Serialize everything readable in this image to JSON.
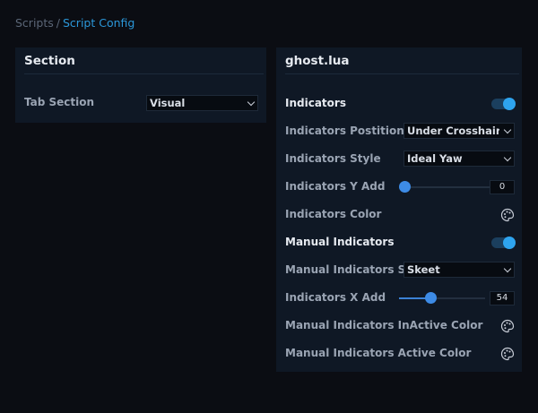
{
  "breadcrumb": {
    "root": "Scripts",
    "separator": "/",
    "current": "Script Config"
  },
  "left_panel": {
    "title": "Section",
    "tab_section": {
      "label": "Tab Section",
      "value": "Visual"
    }
  },
  "right_panel": {
    "title": "ghost.lua",
    "indicators": {
      "label": "Indicators",
      "enabled": true
    },
    "indicators_position": {
      "label": "Indicators Postition",
      "value": "Under Crosshair"
    },
    "indicators_style": {
      "label": "Indicators Style",
      "value": "Ideal Yaw"
    },
    "indicators_y_add": {
      "label": "Indicators Y Add",
      "value": "0",
      "fraction": 0.0
    },
    "indicators_color": {
      "label": "Indicators Color",
      "icon": "palette-icon"
    },
    "manual_indicators": {
      "label": "Manual Indicators",
      "enabled": true
    },
    "manual_indicators_style": {
      "label": "Manual Indicators Style",
      "value": "Skeet"
    },
    "indicators_x_add": {
      "label": "Indicators X Add",
      "value": "54",
      "fraction": 0.36
    },
    "manual_inactive_color": {
      "label": "Manual Indicators InActive Color",
      "icon": "palette-icon"
    },
    "manual_active_color": {
      "label": "Manual Indicators Active Color",
      "icon": "palette-icon"
    }
  },
  "colors": {
    "accent": "#2ea4ef",
    "panel": "#0f1825",
    "background": "#0b0d13"
  }
}
